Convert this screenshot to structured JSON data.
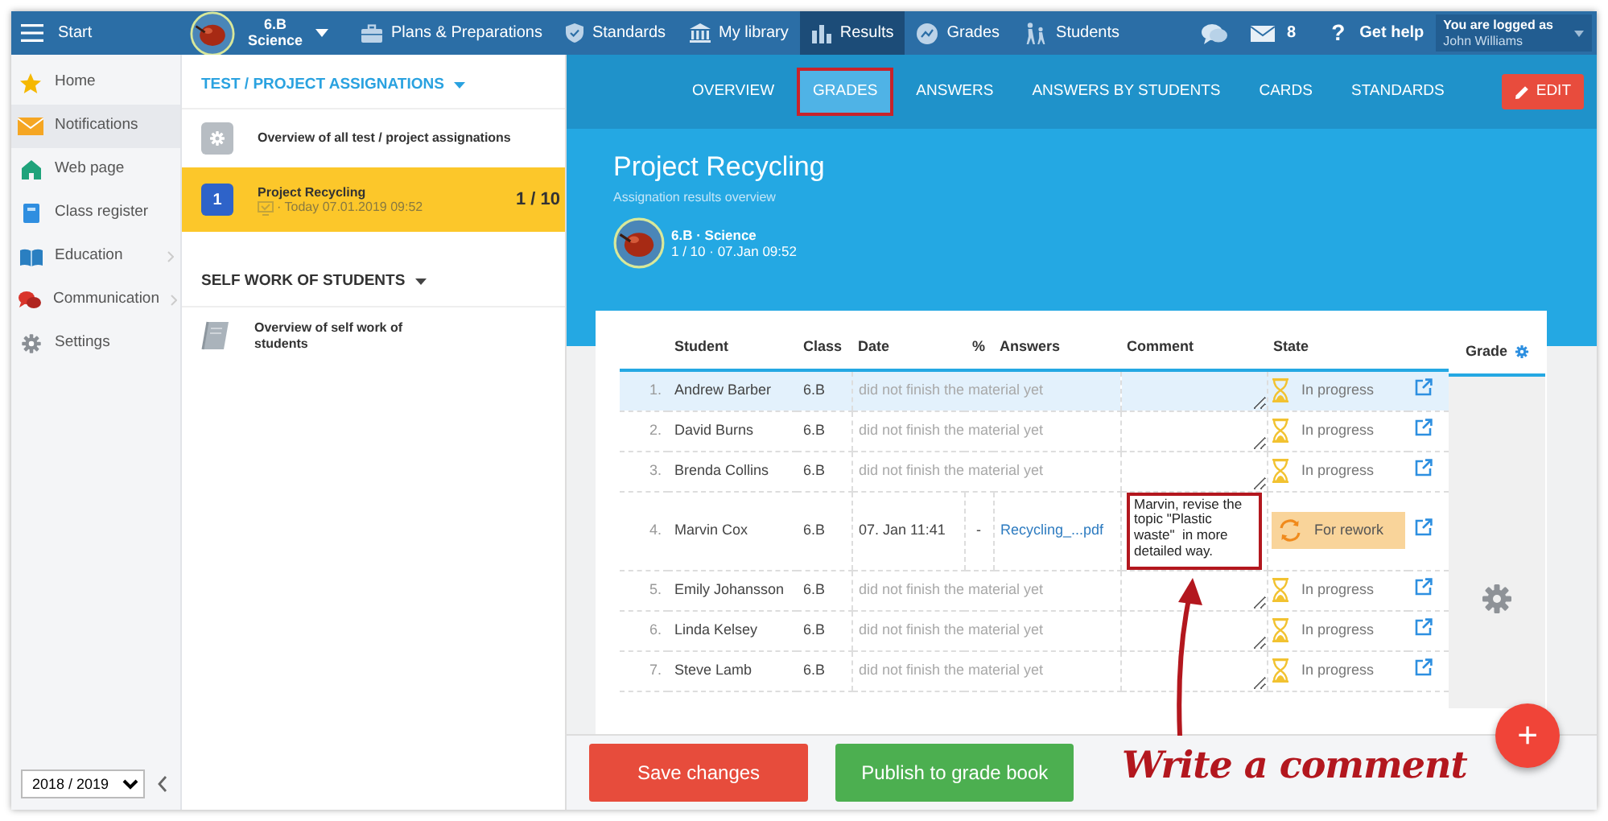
{
  "topbar": {
    "menu_label": "Start",
    "class_selector": {
      "class": "6.B",
      "subject": "Science"
    },
    "nav": [
      {
        "label": "Plans & Preparations",
        "kind": "plans",
        "selected": false
      },
      {
        "label": "Standards",
        "kind": "standards",
        "selected": false
      },
      {
        "label": "My library",
        "kind": "library",
        "selected": false
      },
      {
        "label": "Results",
        "kind": "results",
        "selected": true
      },
      {
        "label": "Grades",
        "kind": "grades",
        "selected": false
      },
      {
        "label": "Students",
        "kind": "students",
        "selected": false
      }
    ],
    "messages_count": "8",
    "help": {
      "glyph": "?",
      "label": "Get help"
    },
    "user": {
      "caption": "You are logged as",
      "name": "John Williams"
    }
  },
  "sidebar": {
    "items": [
      {
        "label": "Home",
        "kind": "home",
        "selected": false,
        "expandable": false
      },
      {
        "label": "Notifications",
        "kind": "notifications",
        "selected": true,
        "expandable": false
      },
      {
        "label": "Web page",
        "kind": "web",
        "selected": false,
        "expandable": false
      },
      {
        "label": "Class register",
        "kind": "register",
        "selected": false,
        "expandable": false
      },
      {
        "label": "Education",
        "kind": "education",
        "selected": false,
        "expandable": true
      },
      {
        "label": "Communication",
        "kind": "communication",
        "selected": false,
        "expandable": true
      },
      {
        "label": "Settings",
        "kind": "settings",
        "selected": false,
        "expandable": false
      }
    ],
    "school_year": "2018 / 2019"
  },
  "assignments": {
    "sections": [
      {
        "title": "TEST / PROJECT ASSIGNATIONS",
        "accent": true,
        "items": [
          {
            "kind": "overview",
            "title": "Overview of all test / project assignations",
            "selected": false
          },
          {
            "kind": "assignment",
            "badge": "1",
            "title": "Project Recycling",
            "subtitle": "· Today 07.01.2019 09:52",
            "count": "1 / 10",
            "selected": true
          }
        ]
      },
      {
        "title": "SELF WORK OF STUDENTS",
        "accent": false,
        "items": [
          {
            "kind": "self_work",
            "title": "Overview of self work of students",
            "selected": false
          }
        ]
      }
    ]
  },
  "tabs": [
    {
      "label": "OVERVIEW",
      "selected": false,
      "highlighted": false
    },
    {
      "label": "GRADES",
      "selected": true,
      "highlighted": true
    },
    {
      "label": "ANSWERS",
      "selected": false,
      "highlighted": false
    },
    {
      "label": "ANSWERS BY STUDENTS",
      "selected": false,
      "highlighted": false
    },
    {
      "label": "CARDS",
      "selected": false,
      "highlighted": false
    },
    {
      "label": "STANDARDS",
      "selected": false,
      "highlighted": false
    }
  ],
  "edit_button": "EDIT",
  "header": {
    "title": "Project Recycling",
    "subtitle": "Assignation results overview",
    "class_line": "6.B · Science",
    "info_line": "1 / 10 · 07.Jan 09:52"
  },
  "table": {
    "columns": [
      "Student",
      "Class",
      "Date",
      "%",
      "Answers",
      "Comment",
      "State",
      "Grade"
    ],
    "rows": [
      {
        "number": "1.",
        "student": "Andrew Barber",
        "class": "6.B",
        "kind": "unfinished",
        "note": "did not finish the material yet",
        "state": {
          "kind": "in_progress",
          "label": "In progress"
        },
        "selected": true
      },
      {
        "number": "2.",
        "student": "David Burns",
        "class": "6.B",
        "kind": "unfinished",
        "note": "did not finish the material yet",
        "state": {
          "kind": "in_progress",
          "label": "In progress"
        },
        "selected": false
      },
      {
        "number": "3.",
        "student": "Brenda Collins",
        "class": "6.B",
        "kind": "unfinished",
        "note": "did not finish the material yet",
        "state": {
          "kind": "in_progress",
          "label": "In progress"
        },
        "selected": false
      },
      {
        "number": "4.",
        "student": "Marvin Cox",
        "class": "6.B",
        "kind": "submitted",
        "date": "07. Jan 11:41",
        "percent": "-",
        "answer_file": "Recycling_...pdf",
        "comment": "Marvin, revise the topic \"Plastic waste\"  in more detailed way.",
        "comment_highlighted": true,
        "state": {
          "kind": "rework",
          "label": "For rework"
        },
        "selected": false
      },
      {
        "number": "5.",
        "student": "Emily Johansson",
        "class": "6.B",
        "kind": "unfinished",
        "note": "did not finish the material yet",
        "state": {
          "kind": "in_progress",
          "label": "In progress"
        },
        "selected": false
      },
      {
        "number": "6.",
        "student": "Linda Kelsey",
        "class": "6.B",
        "kind": "unfinished",
        "note": "did not finish the material yet",
        "state": {
          "kind": "in_progress",
          "label": "In progress"
        },
        "selected": false
      },
      {
        "number": "7.",
        "student": "Steve Lamb",
        "class": "6.B",
        "kind": "unfinished",
        "note": "did not finish the material yet",
        "state": {
          "kind": "in_progress",
          "label": "In progress"
        },
        "selected": false
      }
    ]
  },
  "annotation": {
    "text": "Write a comment"
  },
  "buttons": [
    {
      "label": "Save changes",
      "kind": "danger"
    },
    {
      "label": "Publish to grade book",
      "kind": "success"
    }
  ],
  "fab": "+"
}
